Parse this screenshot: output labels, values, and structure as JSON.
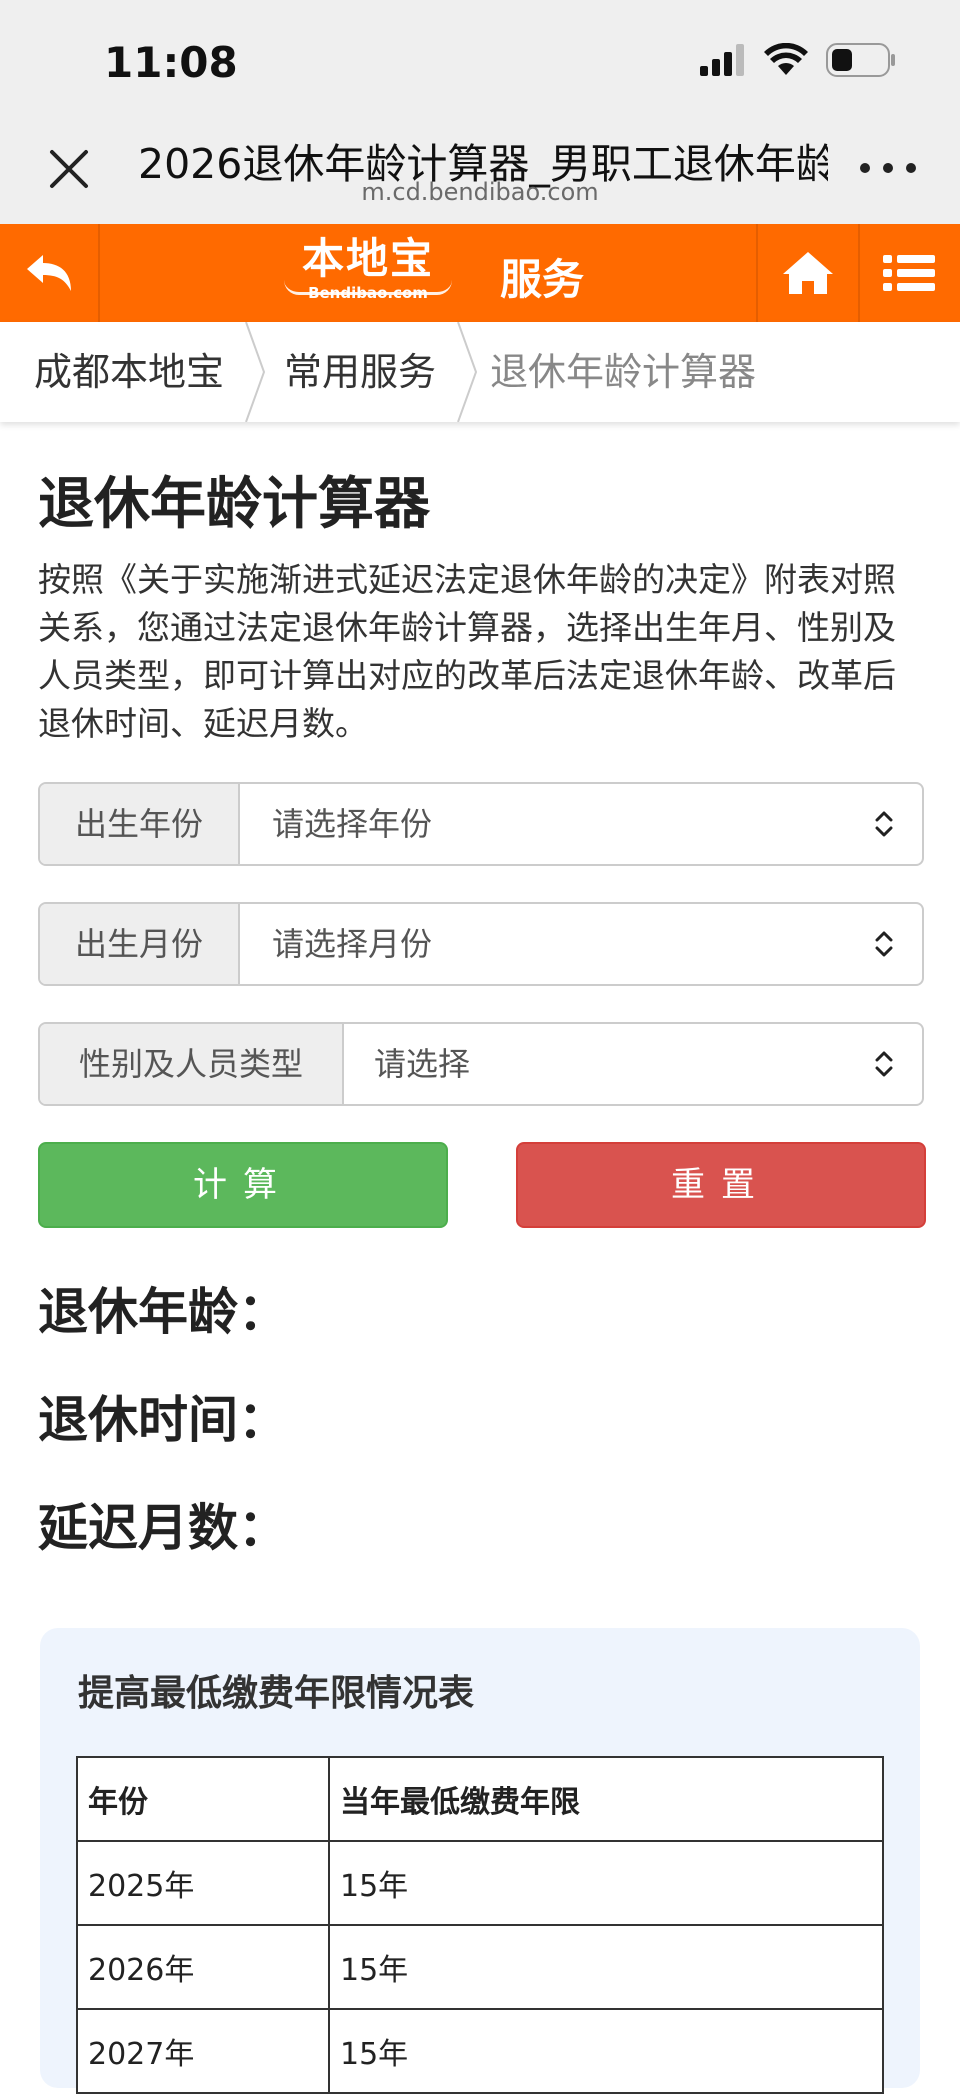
{
  "status_bar": {
    "time": "11:08"
  },
  "browser": {
    "title": "2026退休年龄计算器_男职工退休年龄",
    "url": "m.cd.bendibao.com"
  },
  "header": {
    "logo_cn": "本地宝",
    "logo_en": "Bendibao.com",
    "section": "服务",
    "accent_color": "#ff6a00"
  },
  "breadcrumb": [
    "成都本地宝",
    "常用服务",
    "退休年龄计算器"
  ],
  "page": {
    "title": "退休年龄计算器",
    "intro": "按照《关于实施渐进式延迟法定退休年龄的决定》附表对照关系，您通过法定退休年龄计算器，选择出生年月、性别及人员类型，即可计算出对应的改革后法定退休年龄、改革后退休时间、延迟月数。"
  },
  "form": {
    "birth_year": {
      "label": "出生年份",
      "value": "请选择年份"
    },
    "birth_month": {
      "label": "出生月份",
      "value": "请选择月份"
    },
    "type": {
      "label": "性别及人员类型",
      "value": "请选择"
    },
    "calc_label": "计算",
    "reset_label": "重置"
  },
  "results": {
    "age_label": "退休年龄：",
    "time_label": "退休时间：",
    "delay_label": "延迟月数："
  },
  "table": {
    "title": "提高最低缴费年限情况表",
    "headers": [
      "年份",
      "当年最低缴费年限"
    ],
    "rows": [
      [
        "2025年",
        "15年"
      ],
      [
        "2026年",
        "15年"
      ],
      [
        "2027年",
        "15年"
      ]
    ]
  }
}
